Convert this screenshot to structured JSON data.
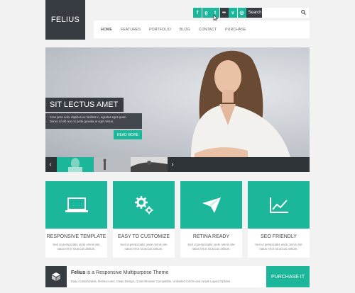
{
  "logo": {
    "text": "FELIUS"
  },
  "social": {
    "icons": [
      {
        "name": "facebook-icon",
        "glyph": "f"
      },
      {
        "name": "google-plus-icon",
        "glyph": "g"
      },
      {
        "name": "twitter-icon",
        "glyph": "t"
      },
      {
        "name": "flickr-icon",
        "glyph": "••"
      },
      {
        "name": "vimeo-icon",
        "glyph": "v"
      },
      {
        "name": "dribbble-icon",
        "glyph": "◎"
      }
    ],
    "search_label": "Search"
  },
  "nav": {
    "items": [
      "HOME",
      "FEATURES",
      "PORTFOLIO",
      "BLOG",
      "CONTACT",
      "PURCHASE"
    ]
  },
  "hero": {
    "title": "SIT LECTUS AMET",
    "desc_line1": "Cras justo odio, dapibus ac facilisis in, egestas eget quam.",
    "desc_line2": "Donec id elit non mi porta gravida at eget metus.",
    "button": "READ MORE",
    "prev": "‹",
    "next": "›"
  },
  "features": [
    {
      "title": "RESPONSIVE TEMPLATE",
      "desc1": "Sed ut perspiciatis unde omnis iste",
      "desc2": "natus error sit accus antium."
    },
    {
      "title": "EASY TO CUSTOMIZE",
      "desc1": "Sed ut perspiciatis unde omnis iste",
      "desc2": "natus error sit accus antium."
    },
    {
      "title": "RETINA READY",
      "desc1": "Sed ut perspiciatis unde omnis iste",
      "desc2": "natus error sit accus antium."
    },
    {
      "title": "SEO FRIENDLY",
      "desc1": "Sed ut perspiciatis unde omnis iste",
      "desc2": "natus error sit accus antium."
    }
  ],
  "bottom": {
    "brand": "Felius",
    "headline": " is a Responsive Multipurpose Theme",
    "sub": "Easy Customizable, Retina Icons, Clean Design, Cross Browser Compatible, Unlimited Colors and Ample Layout Options",
    "button": "PURCHASE IT"
  },
  "colors": {
    "accent": "#1cb79a",
    "dark": "#363c42",
    "bg": "#f2f2f2"
  }
}
